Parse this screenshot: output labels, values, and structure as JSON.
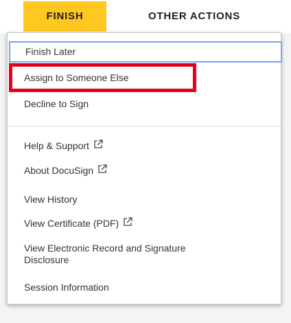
{
  "header": {
    "finish_label": "FINISH",
    "other_actions_label": "OTHER ACTIONS"
  },
  "menu": {
    "items": [
      {
        "label": "Finish Later"
      },
      {
        "label": "Assign to Someone Else"
      },
      {
        "label": "Decline to Sign"
      },
      {
        "label": "Help & Support"
      },
      {
        "label": "About DocuSign"
      },
      {
        "label": "View History"
      },
      {
        "label": "View Certificate (PDF)"
      },
      {
        "label": "View Electronic Record and Signature Disclosure"
      },
      {
        "label": "Session Information"
      }
    ]
  },
  "colors": {
    "finish_button": "#ffc820",
    "focus_outline": "#7ba2ea",
    "highlight_box": "#e3001b"
  },
  "icons": {
    "external_link": "external-link-icon"
  }
}
